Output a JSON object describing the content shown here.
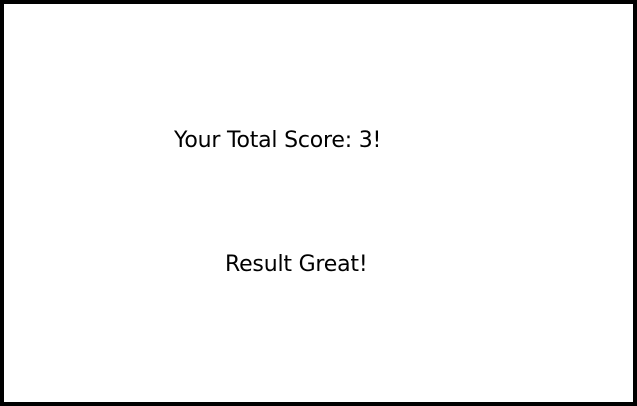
{
  "score_text": "Your Total Score: 3!",
  "result_text": "Result Great!",
  "colors": {
    "border": "#000000",
    "background": "#ffffff",
    "text": "#000000"
  }
}
